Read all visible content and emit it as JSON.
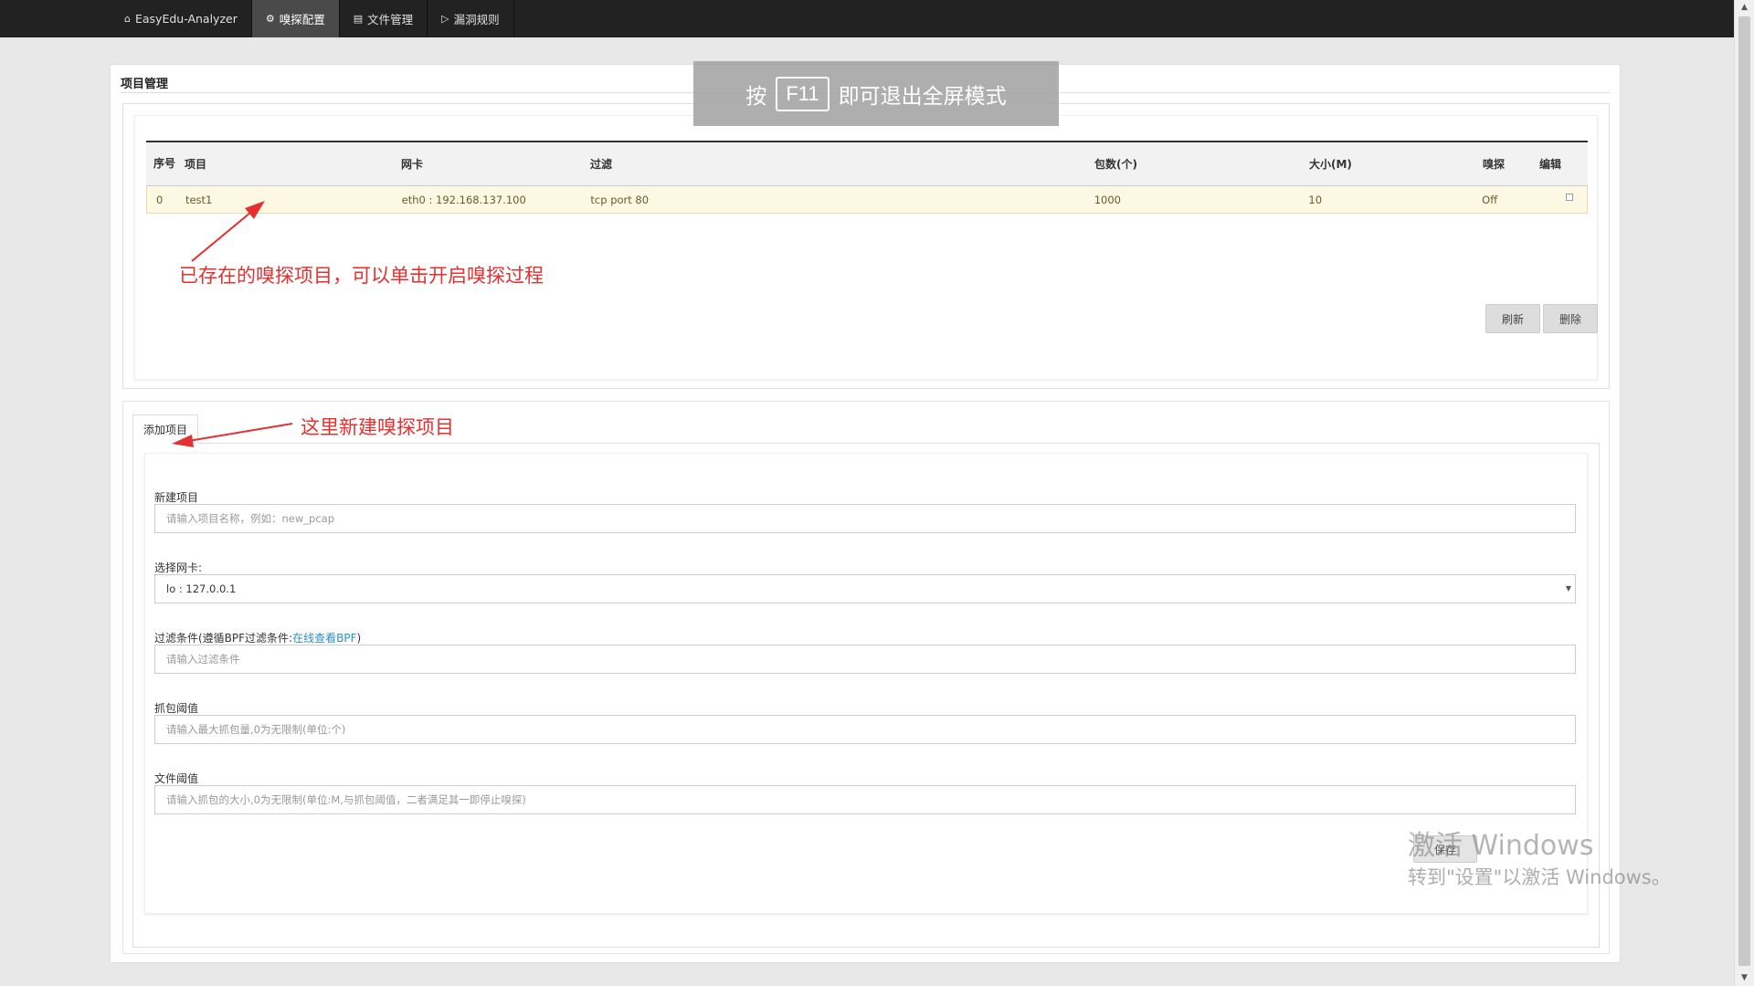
{
  "navbar": {
    "brand": "EasyEdu-Analyzer",
    "items": [
      {
        "label": "嗅探配置",
        "icon": "gear-icon"
      },
      {
        "label": "文件管理",
        "icon": "file-icon"
      },
      {
        "label": "漏洞规则",
        "icon": "bullhorn-icon"
      }
    ]
  },
  "project_panel": {
    "title": "项目管理",
    "columns": [
      "序号",
      "项目",
      "网卡",
      "过滤",
      "包数(个)",
      "大小(M)",
      "嗅探",
      "编辑"
    ],
    "rows": [
      {
        "index": "0",
        "name": "test1",
        "nic": "eth0 : 192.168.137.100",
        "filter": "tcp port 80",
        "packets": "1000",
        "size": "10",
        "sniff": "Off"
      }
    ],
    "refresh_label": "刷新",
    "delete_label": "删除"
  },
  "annotations": {
    "existing": "已存在的嗅探项目，可以单击开启嗅探过程",
    "new": "这里新建嗅探项目"
  },
  "add_project": {
    "tab_label": "添加项目",
    "project_name_label": "新建项目",
    "project_name_placeholder": "请输入项目名称，例如：new_pcap",
    "nic_label": "选择网卡:",
    "nic_value": "lo : 127.0.0.1",
    "filter_label_prefix": "过滤条件(遵循BPF过滤条件:",
    "filter_label_link": "在线查看BPF",
    "filter_label_suffix": ")",
    "filter_placeholder": "请输入过滤条件",
    "packet_limit_label": "抓包阈值",
    "packet_limit_placeholder": "请输入最大抓包量,0为无限制(单位:个)",
    "file_limit_label": "文件阈值",
    "file_limit_placeholder": "请输入抓包的大小,0为无限制(单位:M,与抓包阈值，二者满足其一即停止嗅探)",
    "save_label": "保存"
  },
  "fullscreen_hint": {
    "prefix": "按",
    "key": "F11",
    "suffix": "即可退出全屏模式"
  },
  "watermark": {
    "line1": "激活 Windows",
    "line2": "转到\"设置\"以激活 Windows。"
  },
  "colors": {
    "navbar_bg": "#222222",
    "annotation": "#e53030",
    "row_highlight": "#fdf8e4",
    "link": "#2a8fc9"
  }
}
